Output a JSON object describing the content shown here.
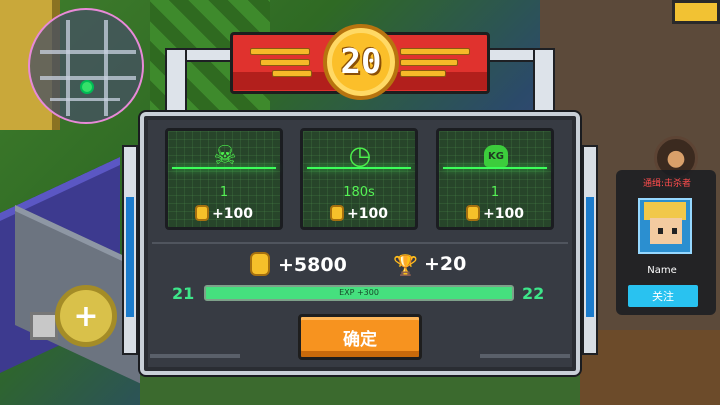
{
  "level_banner": {
    "level": "20"
  },
  "stats": [
    {
      "icon": "skull-crossbones-icon",
      "value": "1",
      "reward": "+100"
    },
    {
      "icon": "stopwatch-icon",
      "value": "180s",
      "reward": "+100"
    },
    {
      "icon": "kettlebell-icon",
      "icon_text": "KG",
      "value": "1",
      "reward": "+100"
    }
  ],
  "totals": {
    "coins": "+5800",
    "trophies": "+20"
  },
  "exp": {
    "from_level": "21",
    "to_level": "22",
    "label": "EXP +300",
    "progress": 1.0
  },
  "confirm_label": "确定",
  "player_card": {
    "wanted_label": "通缉:击杀者",
    "name": "Name",
    "follow_label": "关注"
  },
  "colors": {
    "accent_green": "#45e07e",
    "banner_red": "#e0322e",
    "coin_gold": "#f6c02a",
    "button_orange": "#f7931f",
    "follow_blue": "#29c2f0",
    "wanted_red": "#ff4d4d"
  }
}
